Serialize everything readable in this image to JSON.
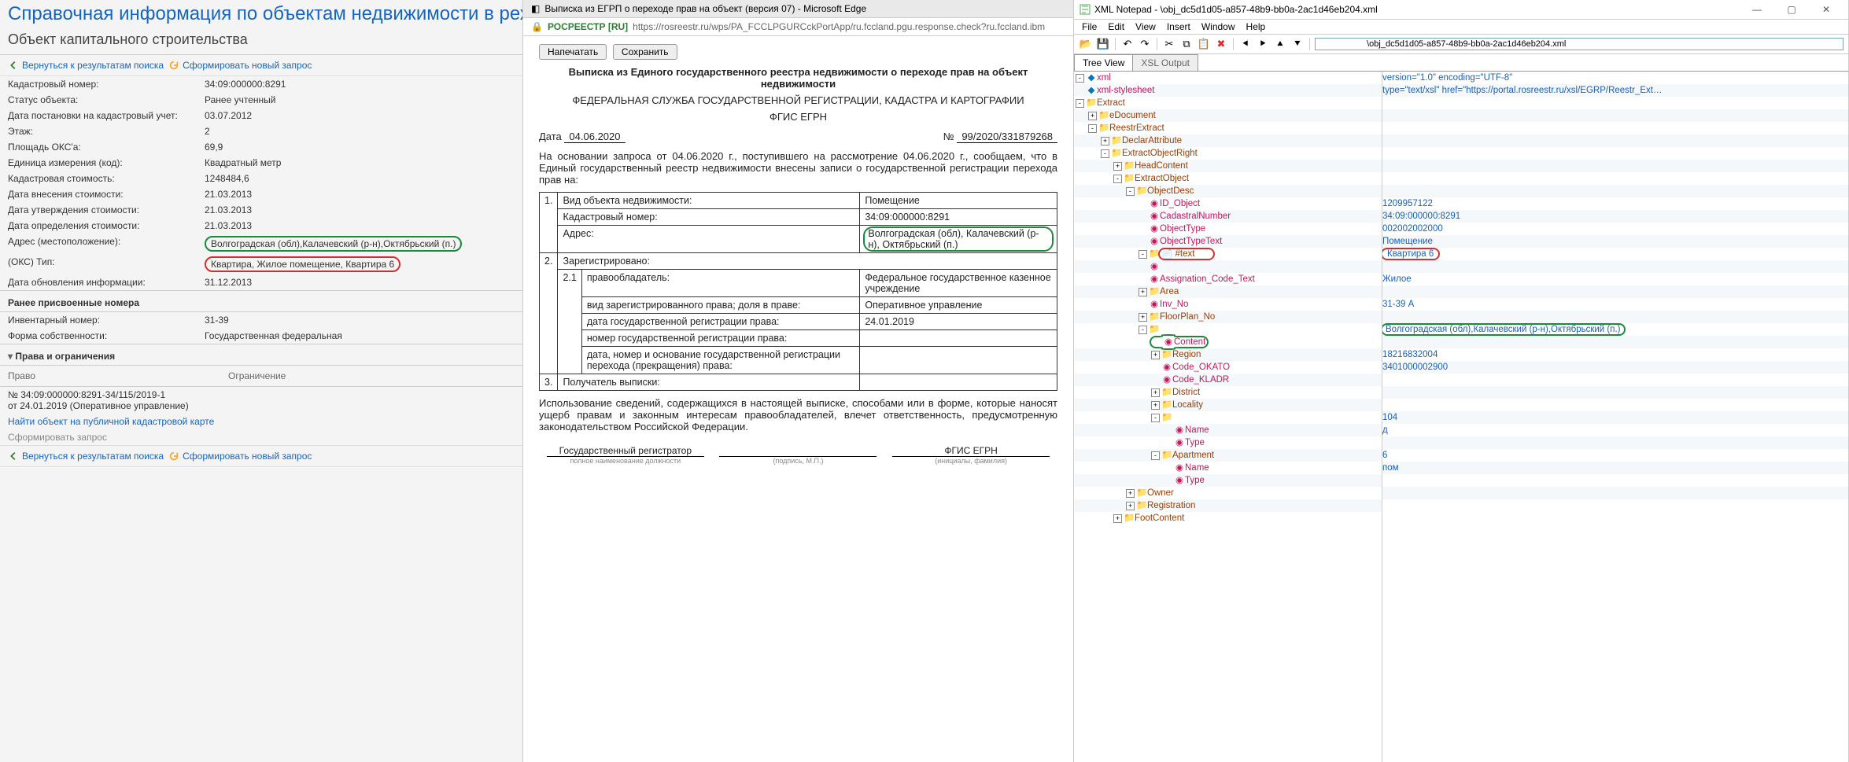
{
  "panel1": {
    "title": "Справочная информация по объектам недвижимости в режим",
    "subtitle": "Объект капитального строительства",
    "back_label": "Вернуться к результатам поиска",
    "new_query_label": "Сформировать новый запрос",
    "rows": {
      "cad_no_k": "Кадастровый номер:",
      "cad_no_v": "34:09:000000:8291",
      "status_k": "Статус объекта:",
      "status_v": "Ранее учтенный",
      "reg_date_k": "Дата постановки на кадастровый учет:",
      "reg_date_v": "03.07.2012",
      "floor_k": "Этаж:",
      "floor_v": "2",
      "area_k": "Площадь ОКС'а:",
      "area_v": "69,9",
      "unit_k": "Единица измерения (код):",
      "unit_v": "Квадратный метр",
      "cost_k": "Кадастровая стоимость:",
      "cost_v": "1248484,6",
      "cost_in_k": "Дата внесения стоимости:",
      "cost_in_v": "21.03.2013",
      "cost_app_k": "Дата утверждения стоимости:",
      "cost_app_v": "21.03.2013",
      "cost_det_k": "Дата определения стоимости:",
      "cost_det_v": "21.03.2013",
      "addr_k": "Адрес (местоположение):",
      "addr_v": "Волгоградская (обл),Калачевский (р-н),Октябрьский (п.)",
      "type_k": "(ОКС) Тип:",
      "type_v": "Квартира, Жилое помещение, Квартира 6",
      "upd_k": "Дата обновления информации:",
      "upd_v": "31.12.2013",
      "prev_no_h": "Ранее присвоенные номера",
      "inv_k": "Инвентарный номер:",
      "inv_v": "31-39",
      "own_k": "Форма собственности:",
      "own_v": "Государственная федеральная",
      "rights_h": "Права и ограничения",
      "rights_c1": "Право",
      "rights_c2": "Ограничение",
      "right_line1": "№ 34:09:000000:8291-34/115/2019-1",
      "right_line2": "от 24.01.2019  (Оперативное управление)",
      "find_link": "Найти объект на публичной кадастровой карте",
      "form_req": "Сформировать запрос"
    }
  },
  "panel2": {
    "tab_title": "Выписка из ЕГРП о переходе прав на объект (версия 07) - Microsoft Edge",
    "site_label": "РОСРЕЕСТР [RU]",
    "url": "https://rosreestr.ru/wps/PA_FCCLPGURCckPortApp/ru.fccland.pgu.response.check?ru.fccland.ibm",
    "btn_print": "Напечатать",
    "btn_save": "Сохранить",
    "h1": "Выписка из Единого государственного реестра недвижимости о переходе прав на объект недвижимости",
    "h2": "ФЕДЕРАЛЬНАЯ СЛУЖБА ГОСУДАРСТВЕННОЙ РЕГИСТРАЦИИ, КАДАСТРА И КАРТОГРАФИИ",
    "h3": "ФГИС ЕГРН",
    "date_lbl": "Дата",
    "date_val": "04.06.2020",
    "no_lbl": "№",
    "no_val": "99/2020/331879268",
    "preamble": "На основании запроса от 04.06.2020 г., поступившего на рассмотрение 04.06.2020 г., сообщаем, что в Единый государственный реестр недвижимости внесены записи о государственной регистрации перехода прав на:",
    "t": {
      "r1a": "Вид объекта недвижимости:",
      "r1b": "Помещение",
      "r2a": "Кадастровый номер:",
      "r2b": "34:09:000000:8291",
      "r3a": "Адрес:",
      "r3b": "Волгоградская (обл), Калачевский (р-н), Октябрьский (п.)",
      "r4a": "Зарегистрировано:",
      "r5a": "правообладатель:",
      "r5b": "Федеральное государственное казенное учреждение",
      "r6a": "вид зарегистрированного права; доля в праве:",
      "r6b": "Оперативное управление",
      "r7a": "дата государственной регистрации права:",
      "r7b": "24.01.2019",
      "r8a": "номер государственной регистрации права:",
      "r9a": "дата, номер и основание государственной регистрации перехода (прекращения) права:",
      "r10a": "Получатель выписки:",
      "n1": "1.",
      "n2": "2.",
      "n21": "2.1",
      "n3": "3."
    },
    "tail": "Использование сведений, содержащихся в настоящей выписке, способами или в форме, которые наносят ущерб правам и законным интересам правообладателей, влечет ответственность, предусмотренную законодательством Российской Федерации.",
    "sig1": "Государственный регистратор",
    "sig1_note": "полное наименование должности",
    "sig2_note": "(подпись, М.П.)",
    "sig3": "ФГИС ЕГРН",
    "sig3_note": "(инициалы, фамилия)"
  },
  "panel3": {
    "app": "XML Notepad -",
    "file_path": "\\obj_dc5d1d05-a857-48b9-bb0a-2ac1d46eb204.xml",
    "menu": [
      "File",
      "Edit",
      "View",
      "Insert",
      "Window",
      "Help"
    ],
    "path_input_prefix": "obj_dc5d1d05-a857-48b9-bb0a-2ac1d46eb204.xml",
    "tabs": {
      "tree": "Tree View",
      "xsl": "XSL Output"
    },
    "tree": [
      {
        "d": 0,
        "t": "-",
        "ic": "pi",
        "lbl": "xml",
        "val": "version=\"1.0\" encoding=\"UTF-8\""
      },
      {
        "d": 0,
        "t": "",
        "ic": "pi",
        "lbl": "xml-stylesheet",
        "val": "type=\"text/xsl\" href=\"https://portal.rosreestr.ru/xsl/EGRP/Reestr_Ext…"
      },
      {
        "d": 0,
        "t": "-",
        "ic": "el",
        "lbl": "Extract",
        "val": ""
      },
      {
        "d": 1,
        "t": "+",
        "ic": "el",
        "lbl": "eDocument",
        "val": ""
      },
      {
        "d": 1,
        "t": "-",
        "ic": "el",
        "lbl": "ReestrExtract",
        "val": ""
      },
      {
        "d": 2,
        "t": "+",
        "ic": "el",
        "lbl": "DeclarAttribute",
        "val": ""
      },
      {
        "d": 2,
        "t": "-",
        "ic": "el",
        "lbl": "ExtractObjectRight",
        "val": ""
      },
      {
        "d": 3,
        "t": "+",
        "ic": "el",
        "lbl": "HeadContent",
        "val": ""
      },
      {
        "d": 3,
        "t": "-",
        "ic": "el",
        "lbl": "ExtractObject",
        "val": ""
      },
      {
        "d": 4,
        "t": "-",
        "ic": "el",
        "lbl": "ObjectDesc",
        "val": ""
      },
      {
        "d": 5,
        "t": "",
        "ic": "at",
        "lbl": "ID_Object",
        "val": "1209957122"
      },
      {
        "d": 5,
        "t": "",
        "ic": "at",
        "lbl": "CadastralNumber",
        "val": "34:09:000000:8291"
      },
      {
        "d": 5,
        "t": "",
        "ic": "at",
        "lbl": "ObjectType",
        "val": "002002002000"
      },
      {
        "d": 5,
        "t": "",
        "ic": "at",
        "lbl": "ObjectTypeText",
        "val": "Помещение"
      },
      {
        "d": 5,
        "t": "-",
        "ic": "el",
        "lbl": "",
        "val": "",
        "hl": "red",
        "inner_text": "#text",
        "inner_val": "Квартира 6",
        "boxed": true
      },
      {
        "d": 5,
        "t": "",
        "ic": "at",
        "lbl": "",
        "val": ""
      },
      {
        "d": 5,
        "t": "",
        "ic": "at",
        "lbl": "Assignation_Code_Text",
        "val": "Жилое"
      },
      {
        "d": 5,
        "t": "+",
        "ic": "el",
        "lbl": "Area",
        "val": ""
      },
      {
        "d": 5,
        "t": "",
        "ic": "at",
        "lbl": "Inv_No",
        "val": "31-39 А"
      },
      {
        "d": 5,
        "t": "+",
        "ic": "el",
        "lbl": "FloorPlan_No",
        "val": ""
      },
      {
        "d": 5,
        "t": "-",
        "ic": "el",
        "lbl": "",
        "val": "",
        "hl": "green",
        "inner_lbl": "Content",
        "inner_val": "Волгоградская (обл),Калачевский (р-н),Октябрьский (п.)",
        "greenrow": true
      },
      {
        "d": 6,
        "t": "+",
        "ic": "el",
        "lbl": "Region",
        "val": ""
      },
      {
        "d": 6,
        "t": "",
        "ic": "at",
        "lbl": "Code_OKATO",
        "val": "18216832004"
      },
      {
        "d": 6,
        "t": "",
        "ic": "at",
        "lbl": "Code_KLADR",
        "val": "3401000002900"
      },
      {
        "d": 6,
        "t": "+",
        "ic": "el",
        "lbl": "District",
        "val": ""
      },
      {
        "d": 6,
        "t": "+",
        "ic": "el",
        "lbl": "Locality",
        "val": ""
      },
      {
        "d": 6,
        "t": "-",
        "ic": "el",
        "lbl": "",
        "val": "",
        "hl": "red2",
        "block": "start"
      },
      {
        "d": 7,
        "t": "",
        "ic": "at",
        "lbl": "Name",
        "val": "104"
      },
      {
        "d": 7,
        "t": "",
        "ic": "at",
        "lbl": "Type",
        "val": "д"
      },
      {
        "d": 6,
        "t": "-",
        "ic": "el",
        "lbl": "Apartment",
        "val": ""
      },
      {
        "d": 7,
        "t": "",
        "ic": "at",
        "lbl": "Name",
        "val": "6"
      },
      {
        "d": 7,
        "t": "",
        "ic": "at",
        "lbl": "Type",
        "val": "пом",
        "hl": "red2",
        "block": "end"
      },
      {
        "d": 4,
        "t": "+",
        "ic": "el",
        "lbl": "Owner",
        "val": ""
      },
      {
        "d": 4,
        "t": "+",
        "ic": "el",
        "lbl": "Registration",
        "val": ""
      },
      {
        "d": 3,
        "t": "+",
        "ic": "el",
        "lbl": "FootContent",
        "val": ""
      }
    ]
  }
}
